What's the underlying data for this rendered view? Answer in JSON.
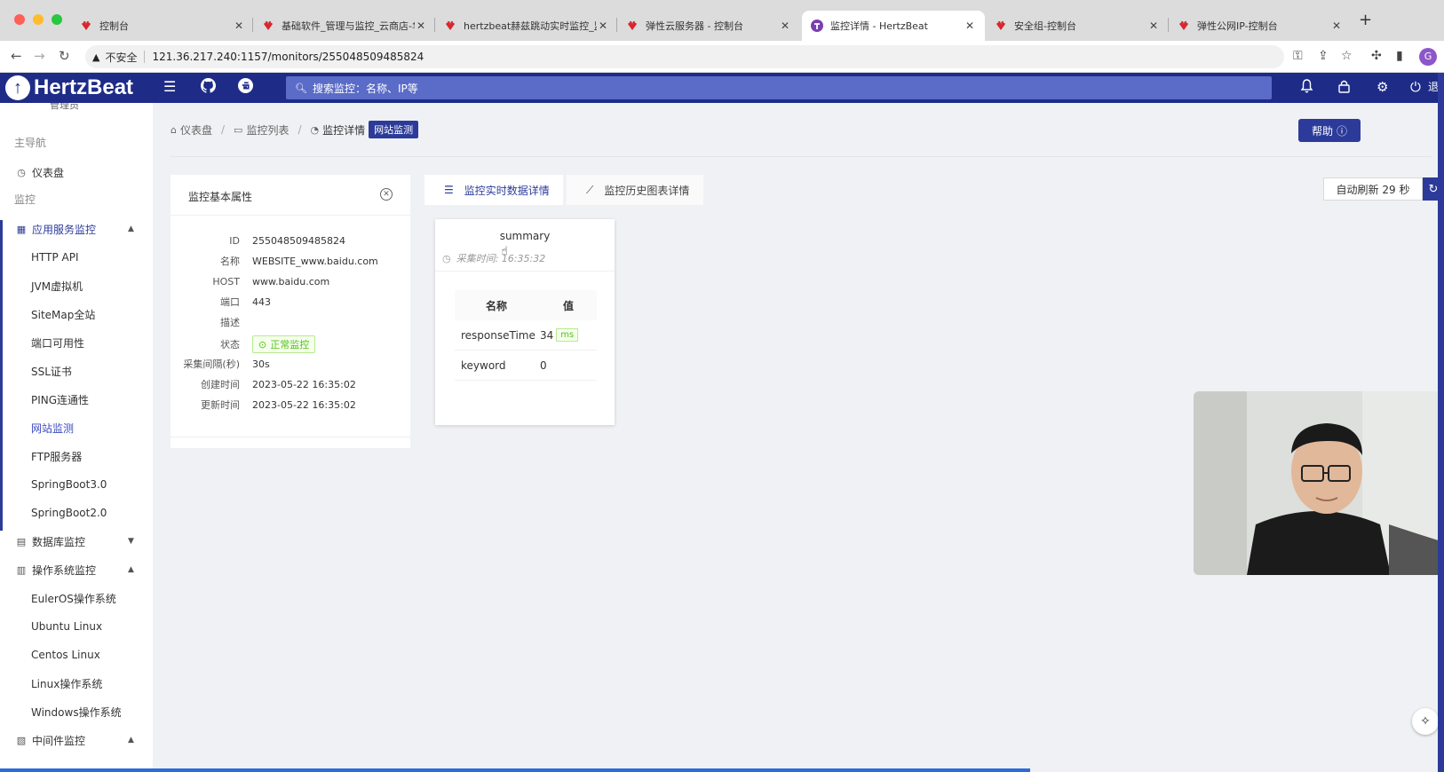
{
  "browser": {
    "tabs": [
      {
        "title": "控制台",
        "favicon": "huawei-icon",
        "active": false
      },
      {
        "title": "基础软件_管理与监控_云商店-华",
        "favicon": "huawei-icon",
        "active": false
      },
      {
        "title": "hertzbeat赫兹跳动实时监控_监",
        "favicon": "huawei-icon",
        "active": false
      },
      {
        "title": "弹性云服务器 - 控制台",
        "favicon": "huawei-icon",
        "active": false
      },
      {
        "title": "监控详情 - HertzBeat",
        "favicon": "hertzbeat-icon",
        "active": true
      },
      {
        "title": "安全组-控制台",
        "favicon": "huawei-icon",
        "active": false
      },
      {
        "title": "弹性公网IP-控制台",
        "favicon": "huawei-icon",
        "active": false
      }
    ],
    "insecure_label": "不安全",
    "url": "121.36.217.240:1157/monitors/255048509485824",
    "profile_initial": "G"
  },
  "header": {
    "logo_text": "HertzBeat",
    "search_placeholder": "搜索监控：名称、IP等",
    "logout_label": "退"
  },
  "sidebar": {
    "cut_text": "管理员",
    "main_nav_label": "主导航",
    "dashboard_label": "仪表盘",
    "monitor_group_label": "监控",
    "groups": [
      {
        "label": "应用服务监控",
        "icon": "grid-icon",
        "expanded": true,
        "items": [
          "HTTP API",
          "JVM虚拟机",
          "SiteMap全站",
          "端口可用性",
          "SSL证书",
          "PING连通性",
          "网站监测",
          "FTP服务器",
          "SpringBoot3.0",
          "SpringBoot2.0"
        ],
        "active_item": "网站监测"
      },
      {
        "label": "数据库监控",
        "icon": "database-icon",
        "expanded": false,
        "items": []
      },
      {
        "label": "操作系统监控",
        "icon": "os-icon",
        "expanded": true,
        "items": [
          "EulerOS操作系统",
          "Ubuntu Linux",
          "Centos Linux",
          "Linux操作系统",
          "Windows操作系统"
        ]
      },
      {
        "label": "中间件监控",
        "icon": "middleware-icon",
        "expanded": true,
        "items": []
      }
    ]
  },
  "breadcrumb": {
    "items": [
      "仪表盘",
      "监控列表",
      "监控详情"
    ],
    "tag": "网站监测"
  },
  "help_label": "帮助",
  "props": {
    "title": "监控基本属性",
    "rows": [
      {
        "key": "ID",
        "value": "255048509485824"
      },
      {
        "key": "名称",
        "value": "WEBSITE_www.baidu.com"
      },
      {
        "key": "HOST",
        "value": "www.baidu.com"
      },
      {
        "key": "端口",
        "value": "443"
      },
      {
        "key": "描述",
        "value": ""
      },
      {
        "key": "状态",
        "value": "正常监控"
      },
      {
        "key": "采集间隔(秒)",
        "value": "30s"
      },
      {
        "key": "创建时间",
        "value": "2023-05-22 16:35:02"
      },
      {
        "key": "更新时间",
        "value": "2023-05-22 16:35:02"
      }
    ]
  },
  "tabs": {
    "realtime_label": "监控实时数据详情",
    "history_label": "监控历史图表详情"
  },
  "auto_refresh_label": "自动刷新 29 秒",
  "summary": {
    "title": "summary",
    "time_label": "采集时间: 16:35:32",
    "headers": [
      "名称",
      "值"
    ],
    "rows": [
      {
        "name": "responseTime",
        "value": "34",
        "unit": "ms"
      },
      {
        "name": "keyword",
        "value": "0",
        "unit": ""
      }
    ]
  },
  "colors": {
    "brand": "#1e2c88",
    "accent": "#2c3b9a",
    "status_green": "#52c41a"
  }
}
